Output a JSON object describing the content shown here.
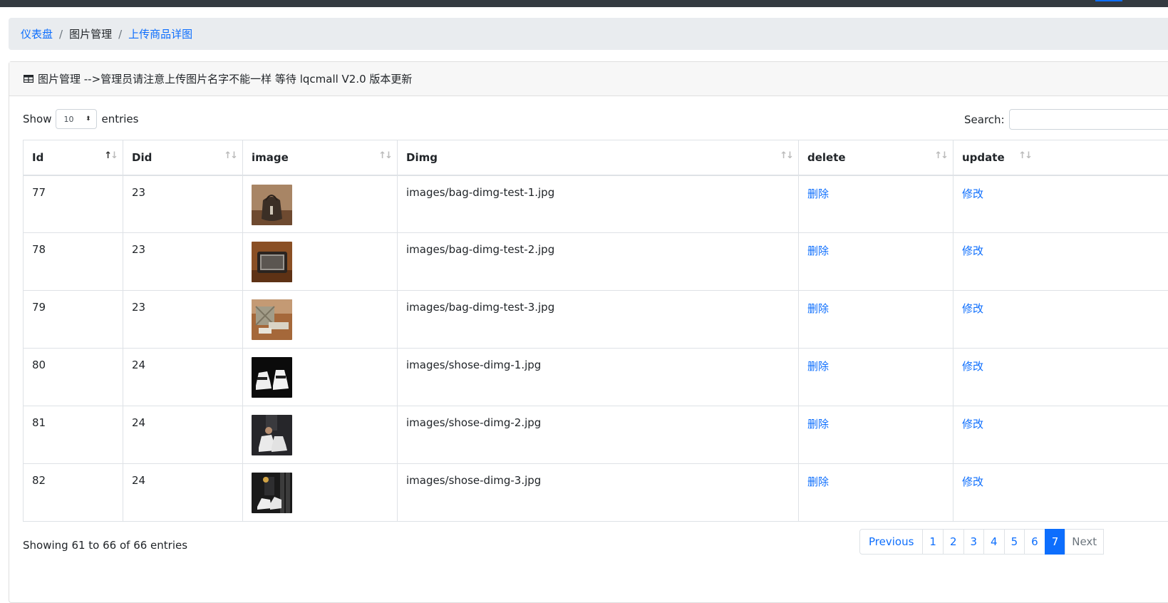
{
  "breadcrumb": {
    "dashboard": "仪表盘",
    "images": "图片管理",
    "current": "上传商品详图"
  },
  "card": {
    "title": "图片管理 -->管理员请注意上传图片名字不能一样 等待 lqcmall V2.0 版本更新",
    "icon": "table-icon"
  },
  "controls": {
    "show_label": "Show",
    "page_size": "10",
    "entries_label": "entries",
    "search_label": "Search:"
  },
  "table": {
    "columns": [
      "Id",
      "Did",
      "image",
      "Dimg",
      "delete",
      "update"
    ],
    "rows": [
      {
        "id": "77",
        "did": "23",
        "image": "bag-thumbnail",
        "dimg": "images/bag-dimg-test-1.jpg",
        "delete": "删除",
        "update": "修改"
      },
      {
        "id": "78",
        "did": "23",
        "image": "bag-thumbnail",
        "dimg": "images/bag-dimg-test-2.jpg",
        "delete": "删除",
        "update": "修改"
      },
      {
        "id": "79",
        "did": "23",
        "image": "bag-thumbnail",
        "dimg": "images/bag-dimg-test-3.jpg",
        "delete": "删除",
        "update": "修改"
      },
      {
        "id": "80",
        "did": "24",
        "image": "shoe-thumbnail",
        "dimg": "images/shose-dimg-1.jpg",
        "delete": "删除",
        "update": "修改"
      },
      {
        "id": "81",
        "did": "24",
        "image": "shoe-thumbnail",
        "dimg": "images/shose-dimg-2.jpg",
        "delete": "删除",
        "update": "修改"
      },
      {
        "id": "82",
        "did": "24",
        "image": "shoe-thumbnail",
        "dimg": "images/shose-dimg-3.jpg",
        "delete": "删除",
        "update": "修改"
      }
    ]
  },
  "footer": {
    "info": "Showing 61 to 66 of 66 entries",
    "pagination": {
      "previous": "Previous",
      "pages": [
        "1",
        "2",
        "3",
        "4",
        "5",
        "6",
        "7"
      ],
      "current": "7",
      "next": "Next"
    }
  },
  "colors": {
    "accent": "#0d6efd",
    "topbar": "#343a40",
    "breadcrumb_bg": "#e9ecef",
    "header_bg": "#f7f7f7"
  }
}
